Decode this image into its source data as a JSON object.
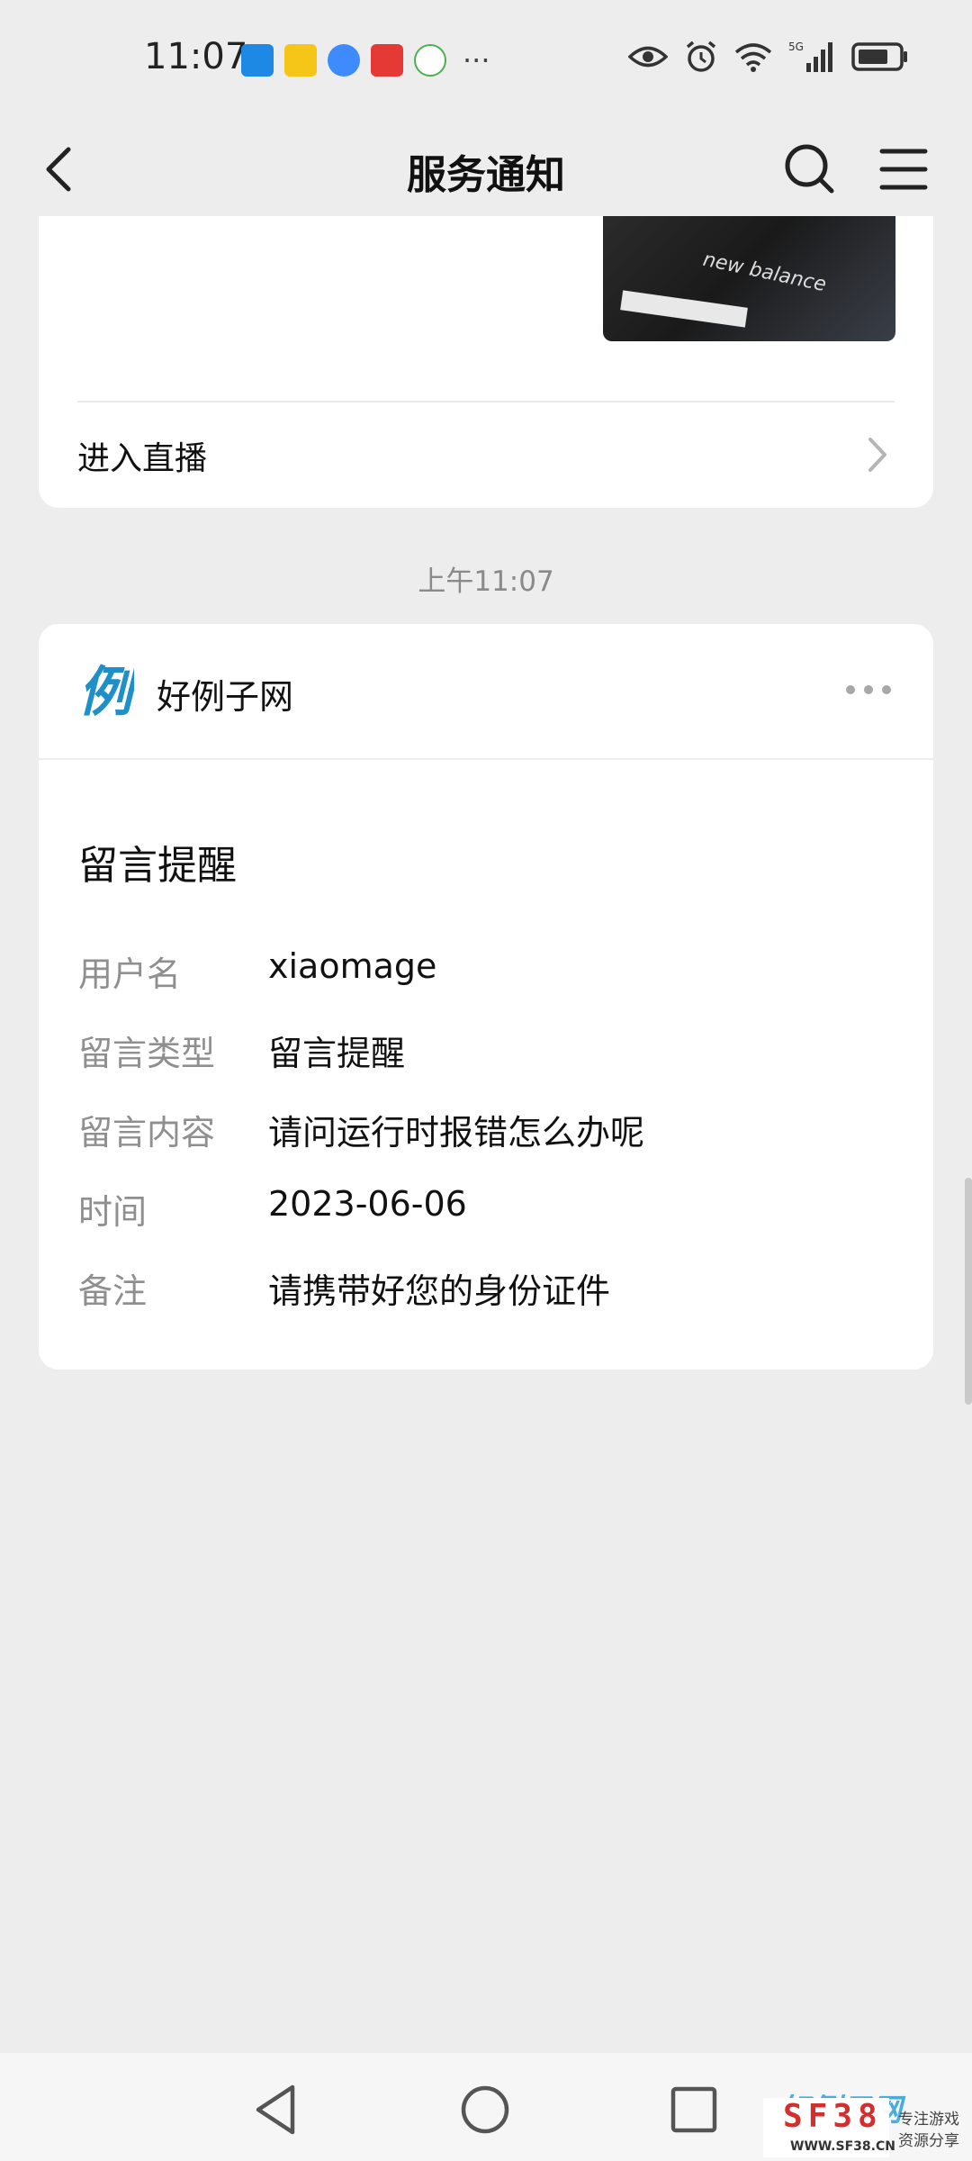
{
  "status_bar": {
    "time": "11:07",
    "notification_icons": [
      "arrow-app-icon",
      "mail-icon",
      "browser-icon",
      "wallet-icon",
      "chat-icon"
    ],
    "more": "···",
    "network": "5G"
  },
  "nav": {
    "title": "服务通知"
  },
  "live_card": {
    "thumbnail_text": "new balance",
    "enter_label": "进入直播"
  },
  "timestamp": "上午11:07",
  "message_card": {
    "brand_logo_char": "例",
    "brand_name": "好例子网",
    "title": "留言提醒",
    "fields": [
      {
        "label": "用户名",
        "value": "xiaomage"
      },
      {
        "label": "留言类型",
        "value": "留言提醒"
      },
      {
        "label": "留言内容",
        "value": "请问运行时报错怎么办呢"
      },
      {
        "label": "时间",
        "value": "2023-06-06"
      },
      {
        "label": "备注",
        "value": "请携带好您的身份证件"
      }
    ]
  },
  "watermark": {
    "overlay_text": "好例子网",
    "brand": "SF38",
    "url": "WWW.SF38.CN",
    "side_lines": [
      "专注游戏",
      "资源分享"
    ]
  },
  "colors": {
    "background": "#ededed",
    "card": "#ffffff",
    "label_gray": "#8f8f8f",
    "brand_blue": "#2aa0d8"
  }
}
